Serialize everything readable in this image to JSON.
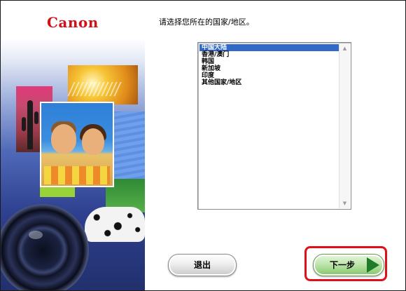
{
  "brand": {
    "logo_text": "Canon"
  },
  "prompt": "请选择您所在的国家/地区。",
  "region_list": {
    "items": [
      "中国大陆",
      "香港/澳门",
      "韩国",
      "新加坡",
      "印度",
      "其他国家/地区"
    ],
    "selected": "中国大陆"
  },
  "buttons": {
    "exit_label": "退出",
    "next_label": "下一步"
  },
  "colors": {
    "brand_red": "#d0121b",
    "selection_blue": "#3169c6",
    "highlight_red": "#e0101a",
    "next_green": "#84c46a"
  },
  "icons": {
    "scroll_up": "scroll-up-arrow-icon",
    "scroll_down": "scroll-down-arrow-icon",
    "next": "play-arrow-icon"
  }
}
